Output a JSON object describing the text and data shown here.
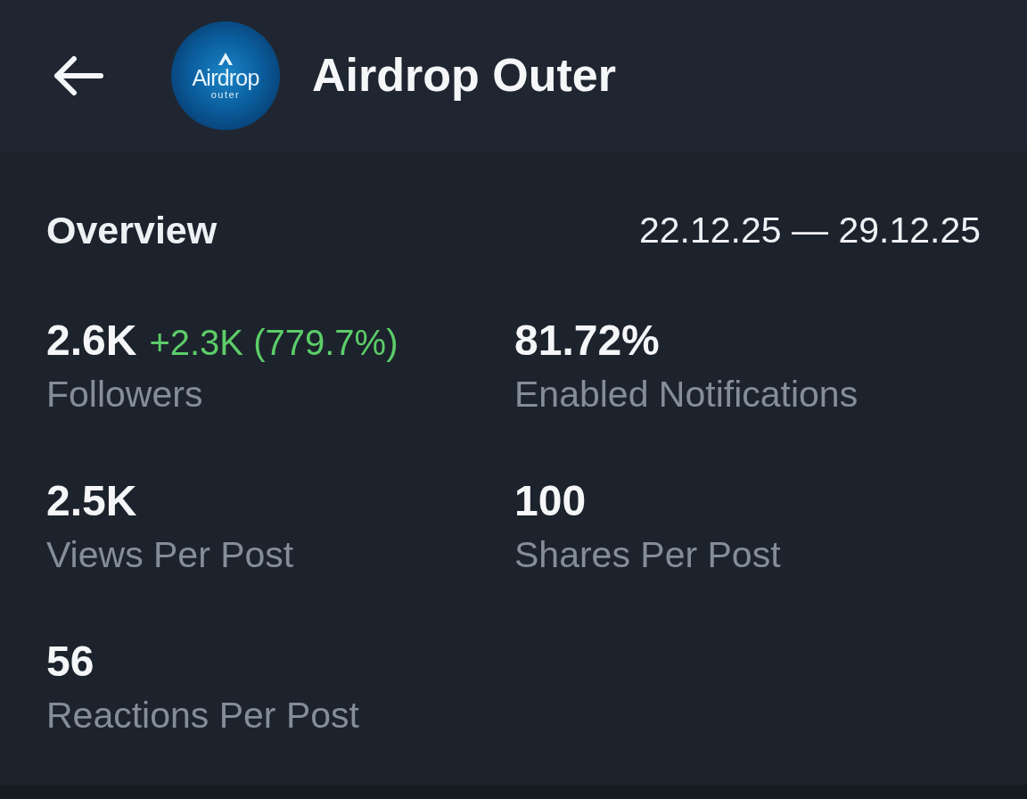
{
  "header": {
    "channel_name": "Airdrop Outer",
    "avatar": {
      "text": "Airdrop",
      "subtext": "outer"
    }
  },
  "overview": {
    "title": "Overview",
    "date_range": "22.12.25 — 29.12.25"
  },
  "stats": [
    {
      "value": "2.6K",
      "change": "+2.3K (779.7%)",
      "label": "Followers"
    },
    {
      "value": "81.72%",
      "label": "Enabled Notifications"
    },
    {
      "value": "2.5K",
      "label": "Views Per Post"
    },
    {
      "value": "100",
      "label": "Shares Per Post"
    },
    {
      "value": "56",
      "label": "Reactions Per Post"
    }
  ]
}
